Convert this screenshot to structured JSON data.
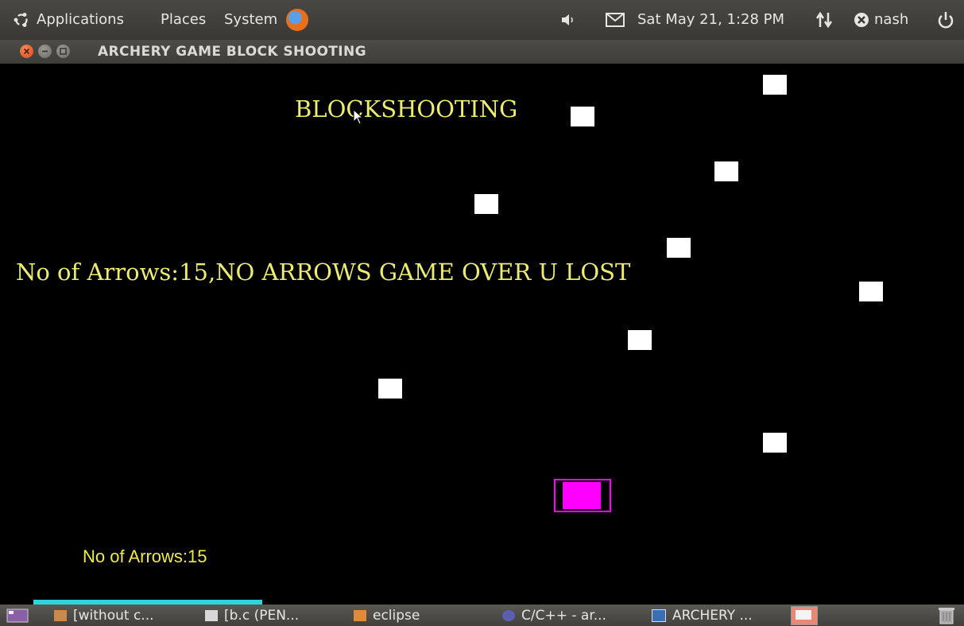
{
  "top_panel": {
    "applications": "Applications",
    "places": "Places",
    "system": "System",
    "datetime": "Sat May 21,  1:28 PM",
    "user": "nash",
    "icons": [
      "ubuntu-logo-icon",
      "firefox-icon",
      "volume-icon",
      "mail-icon",
      "network-icon",
      "user-status-icon",
      "power-icon"
    ]
  },
  "window": {
    "title": "ARCHERY GAME BLOCK SHOOTING",
    "buttons": [
      "close",
      "minimize",
      "maximize"
    ]
  },
  "game": {
    "title": "BLOCKSHOOTING",
    "status": "No of Arrows:15,NO ARROWS GAME OVER U LOST",
    "arrow_count": "No of Arrows:15",
    "colors": {
      "background": "#000000",
      "text": "#ecec74",
      "block": "#ffffff",
      "bow": "#ff00ff",
      "ground": "#2fd6d6"
    }
  },
  "taskbar": {
    "items": [
      {
        "label": "[without c...",
        "icon": "folder-icon"
      },
      {
        "label": "[b.c (PEN...",
        "icon": "text-editor-icon"
      },
      {
        "label": "eclipse",
        "icon": "folder-icon"
      },
      {
        "label": "C/C++ - ar...",
        "icon": "eclipse-icon"
      },
      {
        "label": "ARCHERY ...",
        "icon": "window-icon"
      }
    ]
  }
}
